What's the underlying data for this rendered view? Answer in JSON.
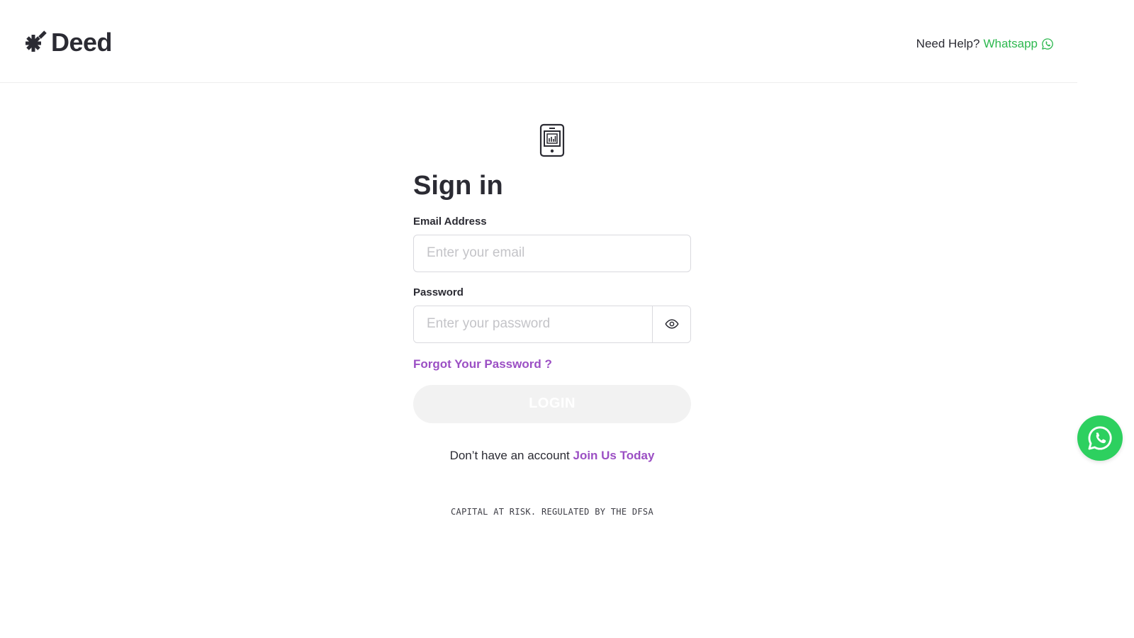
{
  "brand": {
    "name": "Deed",
    "logo_icon": "asterisk-logo-icon",
    "text_color": "#2b2b33"
  },
  "header": {
    "help_label": "Need Help?",
    "help_link": "Whatsapp",
    "help_icon": "whatsapp-icon",
    "link_color": "#2db84f"
  },
  "form": {
    "icon": "tablet-chart-icon",
    "title": "Sign in",
    "email": {
      "label": "Email Address",
      "placeholder": "Enter your email",
      "value": ""
    },
    "password": {
      "label": "Password",
      "placeholder": "Enter your password",
      "value": "",
      "toggle_icon": "eye-icon"
    },
    "forgot_label": "Forgot Your Password ?",
    "login_label": "LOGIN",
    "signup_prompt": "Don’t have an account",
    "signup_link": "Join Us Today",
    "accent_color": "#9b4fc4"
  },
  "footer": {
    "disclaimer": "CAPITAL AT RISK. REGULATED BY THE DFSA"
  },
  "floating_button": {
    "icon": "whatsapp-icon",
    "color": "#2dd05f"
  }
}
